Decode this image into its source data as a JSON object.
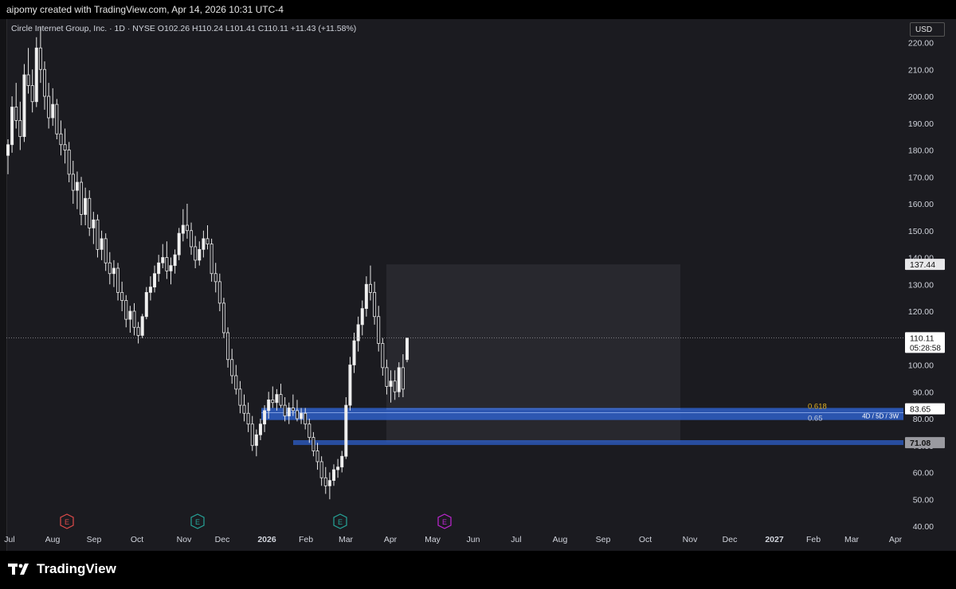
{
  "header": {
    "attribution": "aipomy created with TradingView.com, Apr 14, 2026 10:31 UTC-4"
  },
  "legend": {
    "text": "Circle Internet Group, Inc. · 1D · NYSE  O102.26  H110.24  L101.41  C110.11  +11.43 (+11.58%)"
  },
  "currency": "USD",
  "brand": "TradingView",
  "chart_data": {
    "type": "candlestick",
    "symbol": "Circle Internet Group, Inc.",
    "interval": "1D",
    "exchange": "NYSE",
    "ohlc_last": {
      "open": 102.26,
      "high": 110.24,
      "low": 101.41,
      "close": 110.11,
      "change": 11.43,
      "change_pct": 11.58
    },
    "y_ticks": [
      "40.00",
      "50.00",
      "60.00",
      "70.00",
      "80.00",
      "90.00",
      "100.00",
      "110.00",
      "120.00",
      "130.00",
      "140.00",
      "150.00",
      "160.00",
      "170.00",
      "180.00",
      "190.00",
      "200.00",
      "210.00",
      "220.00"
    ],
    "ylim": [
      37,
      226
    ],
    "x_ticks": [
      "Jul",
      "Aug",
      "Sep",
      "Oct",
      "Nov",
      "Dec",
      "2026",
      "Feb",
      "Mar",
      "Apr",
      "May",
      "Jun",
      "Jul",
      "Aug",
      "Sep",
      "Oct",
      "Nov",
      "Dec",
      "2027",
      "Feb",
      "Mar",
      "Apr"
    ],
    "price_labels": [
      {
        "value": 137.44,
        "text": "137.44",
        "style": "light"
      },
      {
        "value": 110.11,
        "text": "110.11",
        "sub": "05:28:58",
        "style": "white"
      },
      {
        "value": 83.65,
        "text": "83.65",
        "style": "white"
      },
      {
        "value": 71.08,
        "text": "71.08",
        "style": "grey"
      }
    ],
    "zones": [
      {
        "label_1": "0.618",
        "label_2": "0.65",
        "tag": "4D / 5D / 3W",
        "top": 84.0,
        "bottom": 79.5
      },
      {
        "top": 72.0,
        "bottom": 70.2
      }
    ],
    "projection_box": {
      "top": 137.44,
      "bottom": 71.08
    },
    "current_price": 110.11,
    "earnings_markers": [
      {
        "label": "E",
        "color": "#e04a4a"
      },
      {
        "label": "E",
        "color": "#26a69a"
      },
      {
        "label": "E",
        "color": "#26a69a"
      },
      {
        "label": "E",
        "color": "#c026d3"
      }
    ],
    "candles": [
      [
        178,
        184,
        171,
        182
      ],
      [
        182,
        200,
        179,
        196
      ],
      [
        196,
        205,
        188,
        191
      ],
      [
        191,
        198,
        180,
        185
      ],
      [
        185,
        212,
        183,
        208
      ],
      [
        208,
        218,
        201,
        204
      ],
      [
        204,
        210,
        194,
        198
      ],
      [
        198,
        222,
        196,
        218
      ],
      [
        218,
        226,
        205,
        210
      ],
      [
        210,
        213,
        195,
        200
      ],
      [
        200,
        205,
        188,
        192
      ],
      [
        192,
        203,
        189,
        197
      ],
      [
        197,
        199,
        184,
        186
      ],
      [
        186,
        191,
        178,
        182
      ],
      [
        182,
        188,
        175,
        180
      ],
      [
        180,
        183,
        168,
        171
      ],
      [
        171,
        176,
        160,
        165
      ],
      [
        165,
        172,
        158,
        168
      ],
      [
        168,
        170,
        152,
        156
      ],
      [
        156,
        166,
        152,
        162
      ],
      [
        162,
        165,
        148,
        151
      ],
      [
        151,
        157,
        145,
        154
      ],
      [
        154,
        156,
        140,
        143
      ],
      [
        143,
        150,
        139,
        147
      ],
      [
        147,
        149,
        135,
        138
      ],
      [
        138,
        142,
        130,
        134
      ],
      [
        134,
        139,
        129,
        136
      ],
      [
        136,
        138,
        124,
        127
      ],
      [
        127,
        131,
        120,
        124
      ],
      [
        124,
        126,
        114,
        117
      ],
      [
        117,
        122,
        112,
        120
      ],
      [
        120,
        123,
        111,
        114
      ],
      [
        114,
        116,
        108,
        111
      ],
      [
        111,
        119,
        110,
        118
      ],
      [
        118,
        129,
        117,
        127
      ],
      [
        127,
        133,
        124,
        129
      ],
      [
        129,
        137,
        127,
        134
      ],
      [
        134,
        141,
        131,
        138
      ],
      [
        138,
        145,
        136,
        140
      ],
      [
        140,
        146,
        132,
        135
      ],
      [
        135,
        140,
        130,
        137
      ],
      [
        137,
        143,
        134,
        141
      ],
      [
        141,
        151,
        139,
        149
      ],
      [
        149,
        158,
        146,
        152
      ],
      [
        152,
        160,
        147,
        150
      ],
      [
        150,
        153,
        141,
        144
      ],
      [
        144,
        148,
        136,
        139
      ],
      [
        139,
        146,
        137,
        143
      ],
      [
        143,
        150,
        140,
        147
      ],
      [
        147,
        152,
        143,
        145
      ],
      [
        145,
        147,
        131,
        134
      ],
      [
        134,
        138,
        127,
        131
      ],
      [
        131,
        134,
        120,
        123
      ],
      [
        123,
        125,
        110,
        112
      ],
      [
        112,
        114,
        99,
        102
      ],
      [
        102,
        106,
        93,
        96
      ],
      [
        96,
        100,
        89,
        91
      ],
      [
        91,
        94,
        82,
        85
      ],
      [
        85,
        89,
        79,
        82
      ],
      [
        82,
        86,
        75,
        78
      ],
      [
        78,
        81,
        68,
        70
      ],
      [
        70,
        76,
        66,
        74
      ],
      [
        74,
        80,
        72,
        78
      ],
      [
        78,
        85,
        75,
        83
      ],
      [
        83,
        90,
        80,
        87
      ],
      [
        87,
        92,
        84,
        86
      ],
      [
        86,
        91,
        83,
        89
      ],
      [
        89,
        93,
        84,
        85
      ],
      [
        85,
        88,
        79,
        81
      ],
      [
        81,
        86,
        78,
        84
      ],
      [
        84,
        89,
        81,
        83
      ],
      [
        83,
        87,
        79,
        80
      ],
      [
        80,
        84,
        78,
        82
      ],
      [
        82,
        84,
        76,
        78
      ],
      [
        78,
        80,
        71,
        73
      ],
      [
        73,
        75,
        66,
        68
      ],
      [
        68,
        71,
        61,
        64
      ],
      [
        64,
        66,
        55,
        58
      ],
      [
        58,
        62,
        52,
        55
      ],
      [
        55,
        60,
        50,
        57
      ],
      [
        57,
        63,
        55,
        61
      ],
      [
        61,
        65,
        58,
        62
      ],
      [
        62,
        68,
        60,
        66
      ],
      [
        66,
        88,
        65,
        85
      ],
      [
        85,
        103,
        83,
        100
      ],
      [
        100,
        112,
        97,
        109
      ],
      [
        109,
        118,
        105,
        115
      ],
      [
        115,
        124,
        111,
        121
      ],
      [
        121,
        133,
        118,
        130
      ],
      [
        130,
        137,
        124,
        127
      ],
      [
        127,
        131,
        115,
        118
      ],
      [
        118,
        122,
        105,
        108
      ],
      [
        108,
        110,
        96,
        99
      ],
      [
        99,
        102,
        89,
        92
      ],
      [
        92,
        98,
        86,
        94
      ],
      [
        94,
        98,
        87,
        90
      ],
      [
        90,
        101,
        88,
        99
      ],
      [
        99,
        104,
        88,
        91
      ],
      [
        102,
        110,
        101,
        110
      ]
    ]
  }
}
